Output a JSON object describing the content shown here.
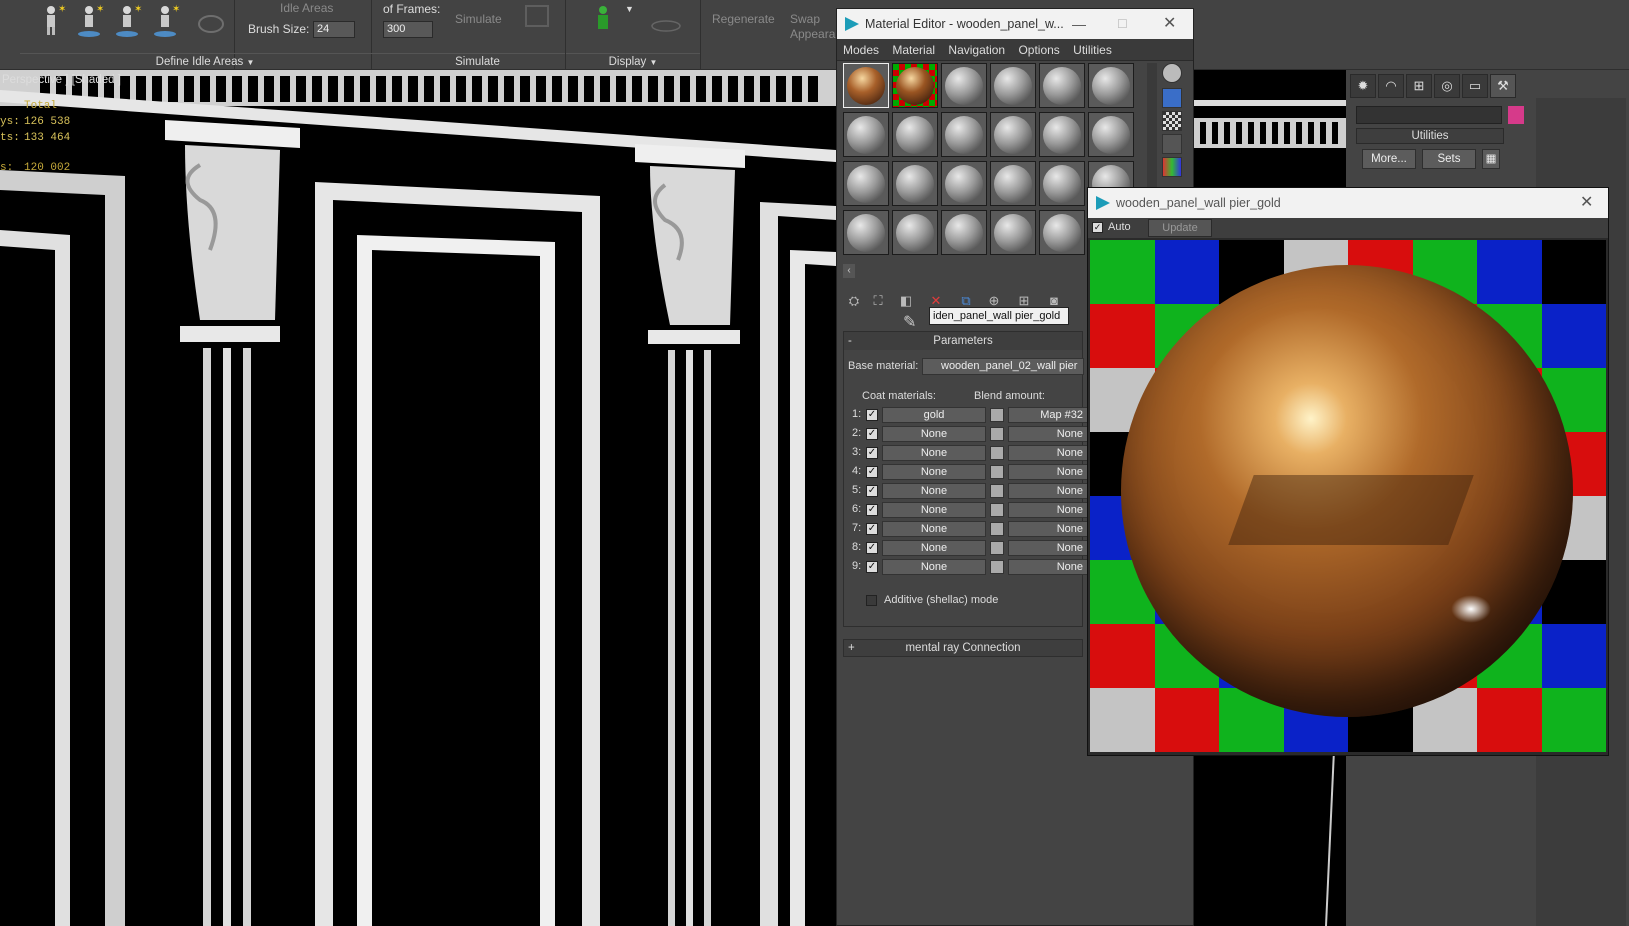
{
  "ribbon": {
    "idle_areas": "Idle Areas",
    "brush_size_label": "Brush Size:",
    "brush_size_value": "24",
    "frames_label": "of Frames:",
    "frames_value": "300",
    "simulate_btn": "Simulate",
    "regenerate_btn": "Regenerate",
    "swap_btn": "Swap\nAppeara",
    "sections": {
      "define_idle": "Define Idle Areas",
      "simulate": "Simulate",
      "display": "Display"
    }
  },
  "viewport": {
    "label": "Perspective ] [Shaded ]",
    "stats": [
      "Total",
      "126 538",
      "133 464",
      "120 002"
    ],
    "stat_labels": [
      "ys:",
      "ts:",
      "s:"
    ]
  },
  "material_editor": {
    "title": "Material Editor - wooden_panel_w...",
    "menu": [
      "Modes",
      "Material",
      "Navigation",
      "Options",
      "Utilities"
    ],
    "material_name": "iden_panel_wall pier_gold",
    "rollout_parameters": "Parameters",
    "base_material_label": "Base material:",
    "base_material_value": "wooden_panel_02_wall pier",
    "coat_label": "Coat materials:",
    "blend_label": "Blend amount:",
    "rows": [
      {
        "n": "1:",
        "mat": "gold",
        "map": "Map #32"
      },
      {
        "n": "2:",
        "mat": "None",
        "map": "None"
      },
      {
        "n": "3:",
        "mat": "None",
        "map": "None"
      },
      {
        "n": "4:",
        "mat": "None",
        "map": "None"
      },
      {
        "n": "5:",
        "mat": "None",
        "map": "None"
      },
      {
        "n": "6:",
        "mat": "None",
        "map": "None"
      },
      {
        "n": "7:",
        "mat": "None",
        "map": "None"
      },
      {
        "n": "8:",
        "mat": "None",
        "map": "None"
      },
      {
        "n": "9:",
        "mat": "None",
        "map": "None"
      }
    ],
    "additive_label": "Additive (shellac) mode",
    "mental_ray": "mental ray Connection"
  },
  "preview": {
    "title": "wooden_panel_wall pier_gold",
    "auto_label": "Auto",
    "update_btn": "Update"
  },
  "command_panel": {
    "rollout": "Utilities",
    "more_btn": "More...",
    "sets_btn": "Sets"
  },
  "colors": {
    "checker_green": "#0fb31d",
    "checker_blue": "#0a22c8",
    "checker_red": "#d80d0d",
    "checker_black": "#000000",
    "checker_gray": "#c4c4c4",
    "gold": "#a8602a",
    "swatch_pink": "#d63a8a"
  }
}
